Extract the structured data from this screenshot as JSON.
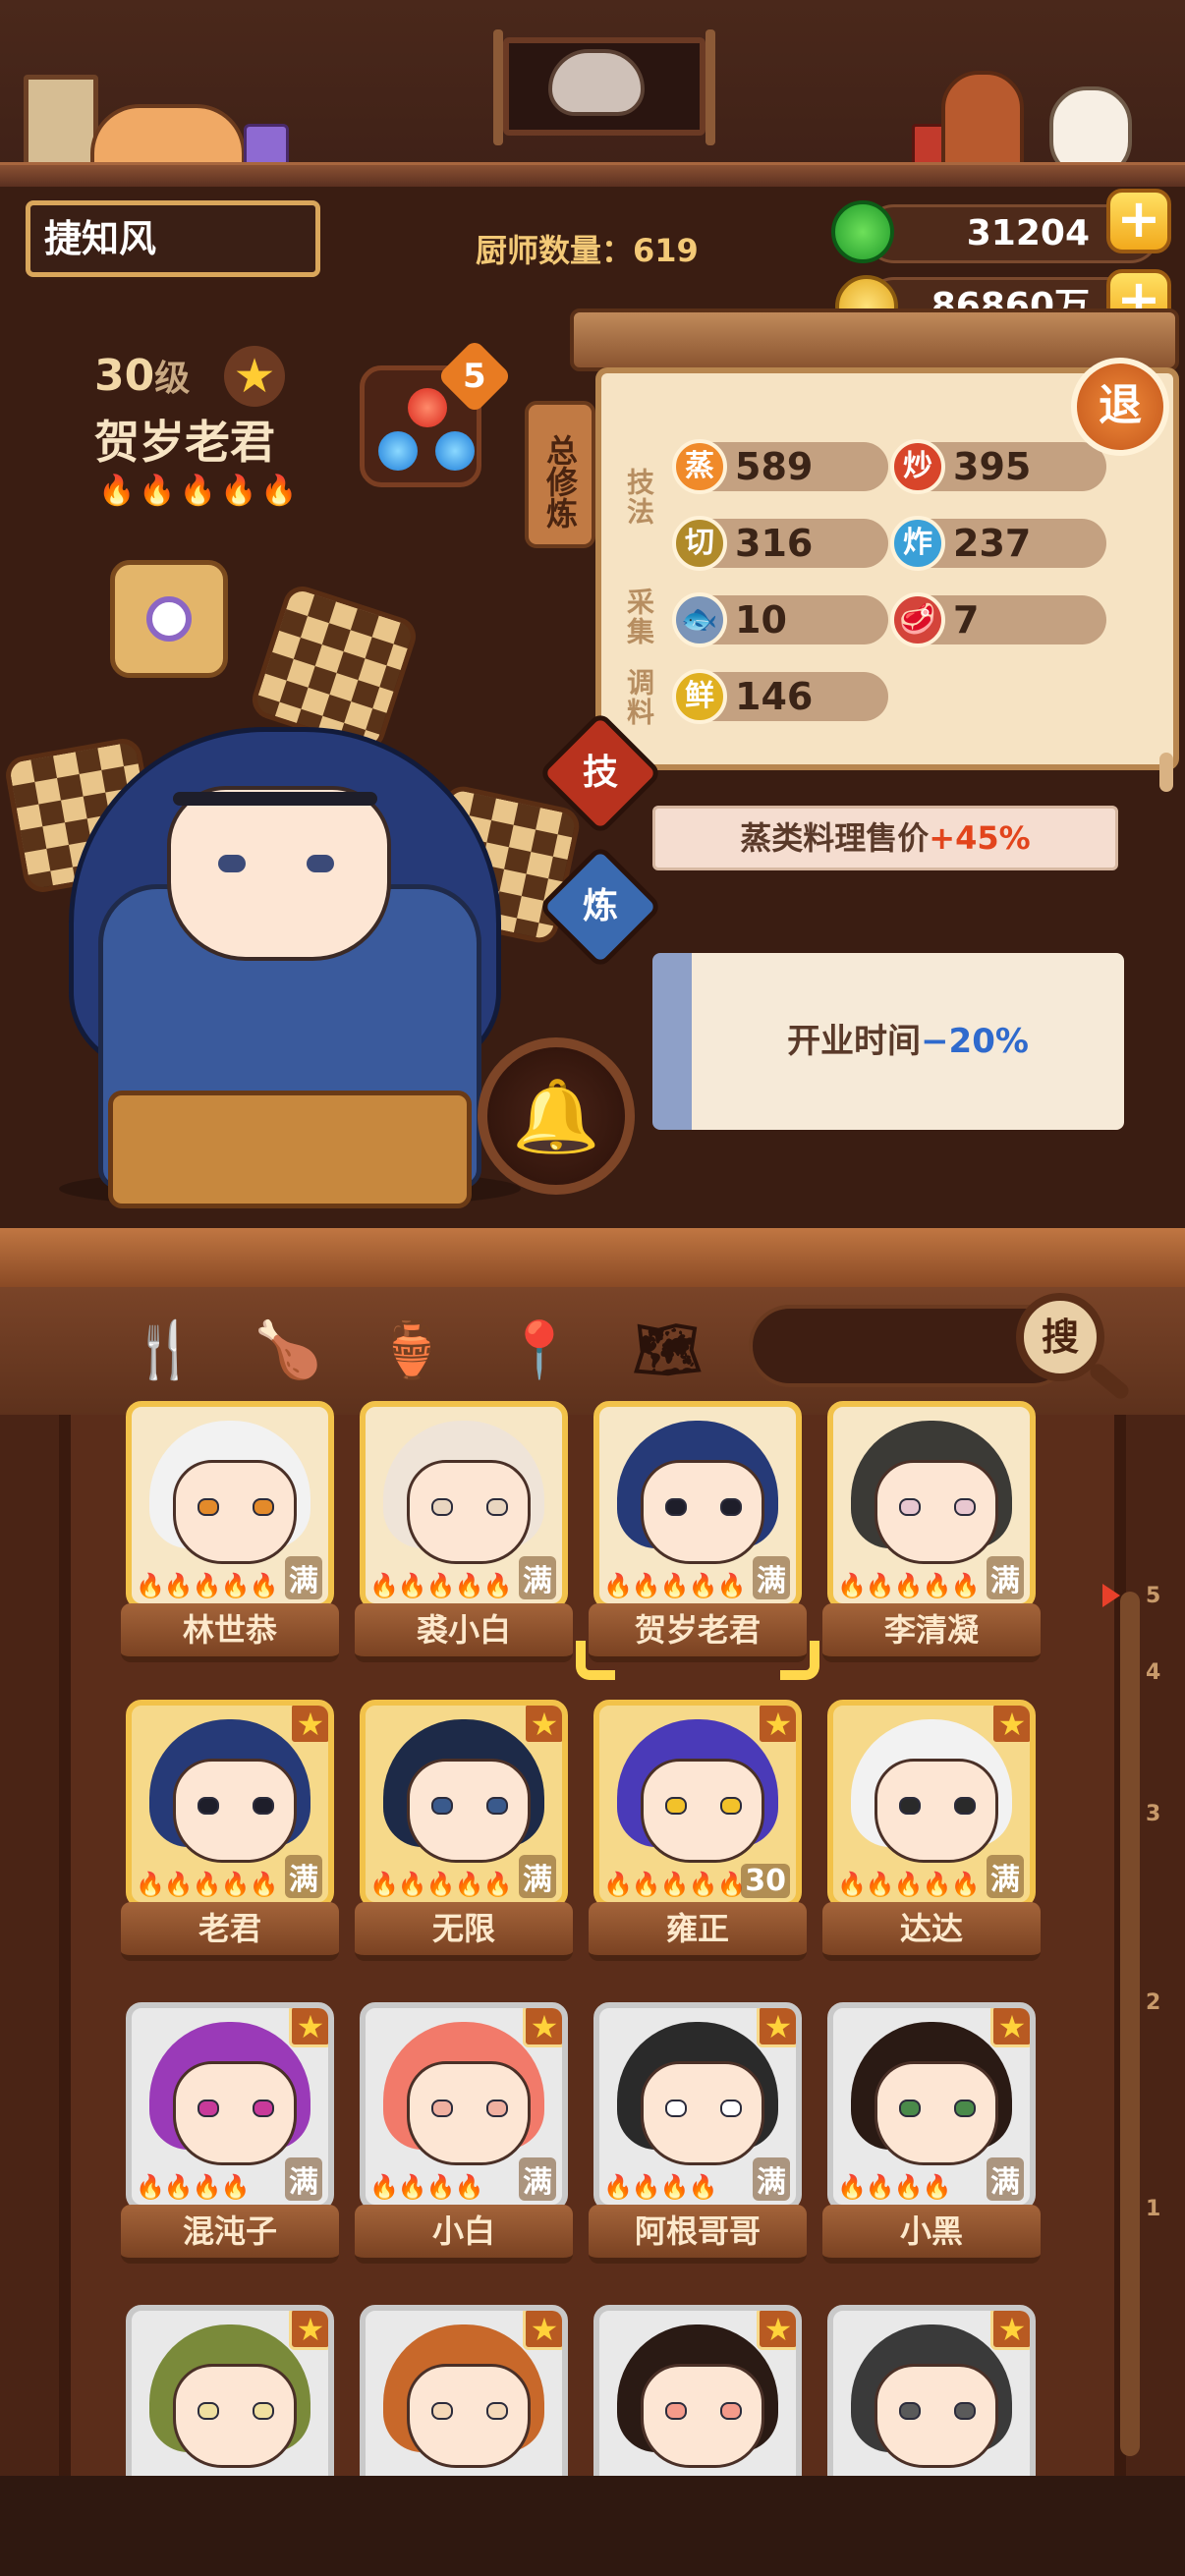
{
  "header": {
    "player_name": "捷知风",
    "chef_count_label": "厨师数量：619",
    "jade": "31204",
    "coins": "86860万",
    "plus": "+"
  },
  "chef": {
    "level": "30",
    "level_suffix": "级",
    "name": "贺岁老君",
    "flames": "🔥🔥🔥🔥🔥",
    "gem_count": "5",
    "star": "★"
  },
  "panel": {
    "tab": "总修炼",
    "exit": "退",
    "labels": {
      "technique": "技法",
      "gather": "采集",
      "seasoning": "调料"
    },
    "stats": [
      {
        "badge": "蒸",
        "value": "589",
        "color": "#f08a2a"
      },
      {
        "badge": "炒",
        "value": "395",
        "color": "#d8452a"
      },
      {
        "badge": "切",
        "value": "316",
        "color": "#b08a2a"
      },
      {
        "badge": "炸",
        "value": "237",
        "color": "#3aa0d8"
      },
      {
        "badge": "",
        "value": "10",
        "color": "#7a94b8"
      },
      {
        "badge": "",
        "value": "7",
        "color": "#d4443a"
      },
      {
        "badge": "鲜",
        "value": "146",
        "color": "#e0b020"
      }
    ],
    "btn_ji": "技",
    "btn_lian": "炼",
    "bonus_prefix": "蒸类料理售价",
    "bonus_value": "+45%",
    "time_prefix": "开业时间",
    "time_value": "−20%"
  },
  "toolbar": {
    "search_button": "搜"
  },
  "chefs": [
    {
      "name": "林世恭",
      "tag": "满",
      "flames": "🔥🔥🔥🔥🔥",
      "hair": "#f2f2f2",
      "accent": "#e38a2a"
    },
    {
      "name": "裘小白",
      "tag": "满",
      "flames": "🔥🔥🔥🔥🔥",
      "hair": "#efe4d8",
      "accent": "#e9d6c0"
    },
    {
      "name": "贺岁老君",
      "tag": "满",
      "flames": "🔥🔥🔥🔥🔥",
      "hair": "#263a78",
      "accent": "#1e1e2a"
    },
    {
      "name": "李清凝",
      "tag": "满",
      "flames": "🔥🔥🔥🔥🔥",
      "hair": "#3b3a36",
      "accent": "#e8c7d0"
    },
    {
      "name": "老君",
      "tag": "满",
      "flames": "🔥🔥🔥🔥🔥",
      "hair": "#263a78",
      "accent": "#1e1e2a"
    },
    {
      "name": "无限",
      "tag": "满",
      "flames": "🔥🔥🔥🔥🔥",
      "hair": "#1d2a48",
      "accent": "#3a5a8c"
    },
    {
      "name": "雍正",
      "tag": "30",
      "flames": "🔥🔥🔥🔥🔥",
      "hair": "#4a3ab8",
      "accent": "#f2c22a"
    },
    {
      "name": "达达",
      "tag": "满",
      "flames": "🔥🔥🔥🔥🔥",
      "hair": "#f2f2f2",
      "accent": "#2a2a2a"
    },
    {
      "name": "混沌子",
      "tag": "满",
      "flames": "🔥🔥🔥🔥",
      "hair": "#9a3ab8",
      "accent": "#c83a9a"
    },
    {
      "name": "小白",
      "tag": "满",
      "flames": "🔥🔥🔥🔥",
      "hair": "#f27a6a",
      "accent": "#f0b0a0"
    },
    {
      "name": "阿根哥哥",
      "tag": "满",
      "flames": "🔥🔥🔥🔥",
      "hair": "#2a2a2a",
      "accent": "#ffffff"
    },
    {
      "name": "小黑",
      "tag": "满",
      "flames": "🔥🔥🔥🔥",
      "hair": "#2a1a14",
      "accent": "#4a8a4a"
    },
    {
      "name": "",
      "tag": "",
      "flames": "",
      "hair": "#7a8a3a",
      "accent": "#f0e0a0"
    },
    {
      "name": "",
      "tag": "",
      "flames": "",
      "hair": "#c8682a",
      "accent": "#f4d8b8"
    },
    {
      "name": "",
      "tag": "",
      "flames": "",
      "hair": "#2a1a14",
      "accent": "#f49a8a"
    },
    {
      "name": "",
      "tag": "",
      "flames": "",
      "hair": "#3a3a3a",
      "accent": "#5a5a5a"
    }
  ],
  "ruler_numbers": [
    "5",
    "4",
    "3",
    "2",
    "1"
  ],
  "icons": [
    "fork-knife-icon",
    "drumstick-icon",
    "jar-icon",
    "location-pin-icon",
    "map-question-icon",
    "star-icon",
    "bell-icon",
    "search-icon"
  ]
}
